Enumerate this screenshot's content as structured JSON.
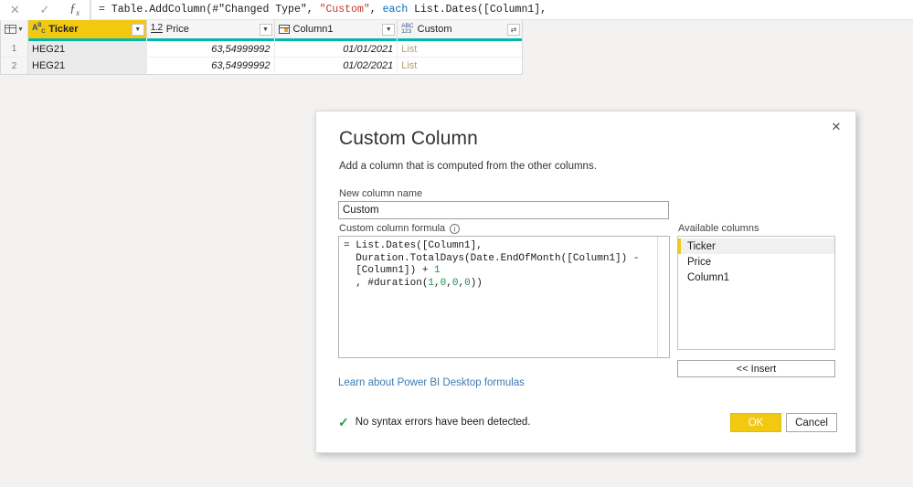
{
  "formula_bar": {
    "cancel_icon": "close-icon",
    "accept_icon": "checkmark-icon",
    "fx_icon": "fx",
    "formula_tokens": [
      {
        "t": "= ",
        "c": "op"
      },
      {
        "t": "Table.AddColumn(#",
        "c": "plain"
      },
      {
        "t": "\"Changed Type\"",
        "c": "plain"
      },
      {
        "t": ", ",
        "c": "plain"
      },
      {
        "t": "\"Custom\"",
        "c": "str"
      },
      {
        "t": ", ",
        "c": "plain"
      },
      {
        "t": "each",
        "c": "kw"
      },
      {
        "t": " List.Dates([Column1],",
        "c": "plain"
      }
    ],
    "formula_plain": "= Table.AddColumn(#\"Changed Type\", \"Custom\", each List.Dates([Column1],"
  },
  "grid": {
    "table_icon": "grid-table-icon",
    "columns": [
      {
        "name": "Ticker",
        "type_icon": "abc-text-icon",
        "type_glyph": "Aᴮᴄ",
        "width": 130,
        "selected": true,
        "control": "dropdown"
      },
      {
        "name": "Price",
        "type_icon": "decimal-number-icon",
        "type_glyph": "1.2",
        "width": 140,
        "selected": false,
        "control": "dropdown"
      },
      {
        "name": "Column1",
        "type_icon": "date-icon",
        "type_glyph": "",
        "width": 135,
        "selected": false,
        "control": "dropdown"
      },
      {
        "name": "Custom",
        "type_icon": "any-type-icon",
        "type_glyph": "ABC\n123",
        "width": 136,
        "selected": false,
        "control": "expand"
      }
    ],
    "rows": [
      {
        "num": "1",
        "Ticker": "HEG21",
        "Price": "63,54999992",
        "Column1": "01/01/2021",
        "Custom": "List"
      },
      {
        "num": "2",
        "Ticker": "HEG21",
        "Price": "63,54999992",
        "Column1": "01/02/2021",
        "Custom": "List"
      }
    ]
  },
  "dialog": {
    "title": "Custom Column",
    "subtitle": "Add a column that is computed from the other columns.",
    "close_icon": "close-icon",
    "new_column_label": "New column name",
    "new_column_value": "Custom",
    "new_column_placeholder": "New column name",
    "formula_label": "Custom column formula",
    "info_icon": "info-icon",
    "formula_lines": [
      [
        {
          "t": "= List.Dates([Column1],",
          "c": "plain"
        }
      ],
      [
        {
          "t": "  Duration.TotalDays(Date.EndOfMonth([Column1]) -",
          "c": "plain"
        }
      ],
      [
        {
          "t": "  [Column1]) + ",
          "c": "plain"
        },
        {
          "t": "1",
          "c": "num"
        }
      ],
      [
        {
          "t": "  , #duration(",
          "c": "plain"
        },
        {
          "t": "1",
          "c": "num"
        },
        {
          "t": ",",
          "c": "plain"
        },
        {
          "t": "0",
          "c": "num"
        },
        {
          "t": ",",
          "c": "plain"
        },
        {
          "t": "0",
          "c": "num"
        },
        {
          "t": ",",
          "c": "plain"
        },
        {
          "t": "0",
          "c": "num"
        },
        {
          "t": "))",
          "c": "plain"
        }
      ]
    ],
    "formula_plain": "= List.Dates([Column1],\n  Duration.TotalDays(Date.EndOfMonth([Column1]) -\n  [Column1]) + 1\n  , #duration(1,0,0,0))",
    "available_label": "Available columns",
    "available_columns": [
      {
        "label": "Ticker",
        "selected": true
      },
      {
        "label": "Price",
        "selected": false
      },
      {
        "label": "Column1",
        "selected": false
      }
    ],
    "insert_label": "<< Insert",
    "learn_link": "Learn about Power BI Desktop formulas",
    "status_icon": "checkmark-icon",
    "status_text": "No syntax errors have been detected.",
    "ok_label": "OK",
    "cancel_label": "Cancel"
  },
  "colors": {
    "accent_yellow": "#f2c811",
    "teal_rule": "#01b8aa",
    "link_blue": "#3b7cb5",
    "success_green": "#2c9c43",
    "string_red": "#c0392b",
    "keyword_blue": "#0070c0",
    "page_background": "#f3f2f1"
  }
}
